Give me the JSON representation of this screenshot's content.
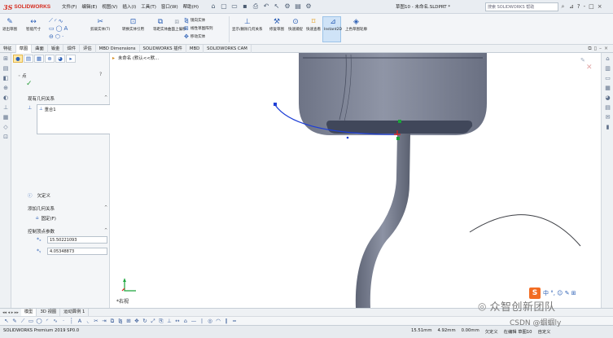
{
  "app": {
    "logo_ds": "3S",
    "logo_name": "SOLIDWORKS",
    "menus": [
      "文件(F)",
      "编辑(E)",
      "视图(V)",
      "插入(I)",
      "工具(T)",
      "窗口(W)",
      "帮助(H)"
    ],
    "doc_title": "草图10 - 未命名.SLDPRT *",
    "search_placeholder": "搜索 SOLIDWORKS 帮助",
    "win_icons": [
      "⊿",
      "?",
      "-",
      "□",
      "×"
    ]
  },
  "ribbon": {
    "exit_sketch": "退出草图",
    "smart_dim": "智能尺寸",
    "trim": "剪裁实体(T)",
    "convert": "转换实体引用",
    "offset": "等距实体",
    "surface_offset": "曲面上偏移",
    "mirror": "镜向实体",
    "linear_pattern": "线性草图阵列",
    "move": "移动实体",
    "display_relations": "显示/删除几何关系",
    "repair": "修复草图",
    "quick_snap": "快速捕捉",
    "quick_view": "快速查看",
    "instant2d": "Instant2D",
    "shaded": "上色草图轮廓"
  },
  "tabs": [
    "特征",
    "草图",
    "曲面",
    "钣金",
    "焊件",
    "评估",
    "MBD Dimensions",
    "SOLIDWORKS 插件",
    "MBD",
    "SOLIDWORKS CAM"
  ],
  "active_tab": 1,
  "tree_root": "未命名 (默认<<默...",
  "pm": {
    "title": "点",
    "existing_title": "现有几何关系",
    "relation_item": "重合1",
    "status": "欠定义",
    "add_title": "添加几何关系",
    "fix_label": "固定(F)",
    "params_title": "控制顶点参数",
    "x_value": "15.50221093",
    "y_value": "4.05348873"
  },
  "view_orient": "*右视",
  "bottom_tabs": [
    "模型",
    "3D 视图",
    "运动算例 1"
  ],
  "active_bottom_tab": 0,
  "status": {
    "left": "SOLIDWORKS Premium 2019 SP0.0",
    "items": [
      "15.51mm",
      "4.92mm",
      "0.00mm",
      "欠定义",
      "在编辑 草图10",
      "自定义"
    ]
  },
  "watermark": {
    "badge_s": "S",
    "badge_icons": "中 °, ☺ ✎ ⊞",
    "team": "众智创新团队",
    "csdn": "CSDN @蝈蝈ly"
  },
  "colors": {
    "spline": "#1e3fd6",
    "body_top": "#6f7586",
    "body_mid": "#8a90a2",
    "accent": "#d52b1e"
  }
}
